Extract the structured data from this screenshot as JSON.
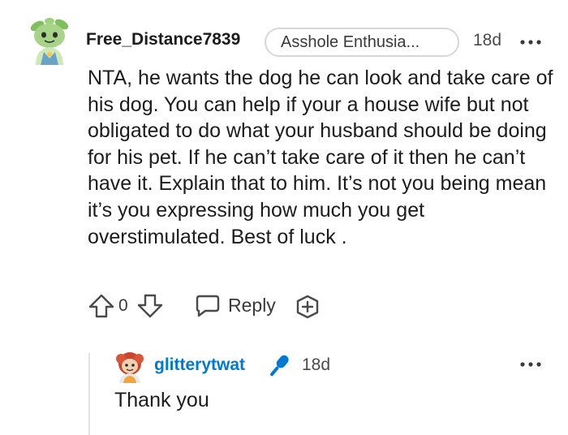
{
  "comment": {
    "username": "Free_Distance7839",
    "flair": "Asshole Enthusia...",
    "age": "18d",
    "body": "NTA, he wants the dog he can look and take care of his dog. You can help if your a house wife but not obligated to do what your husband should be doing for his pet. If he can’t take care of it then he can’t have it. Explain that to him. It’s not you being mean it’s you expressing how much you get overstimulated. Best of luck .",
    "score": "0",
    "reply_label": "Reply",
    "icons": {
      "avatar": "user-avatar-icon",
      "more": "more-options-icon",
      "upvote": "upvote-arrow-icon",
      "downvote": "downvote-arrow-icon",
      "reply": "reply-bubble-icon",
      "award": "award-plus-icon"
    }
  },
  "reply": {
    "username": "glitterytwat",
    "age": "18d",
    "body": "Thank you",
    "icons": {
      "avatar": "user-avatar-icon",
      "badge": "microphone-icon",
      "more": "more-options-icon"
    }
  },
  "colors": {
    "text": "#1c1c1c",
    "muted": "#4a4a4a",
    "reply_username": "#0079d3",
    "flair_border": "#d7d7d7",
    "thread_line": "#e2e2e2",
    "mic": "#0079d3"
  }
}
